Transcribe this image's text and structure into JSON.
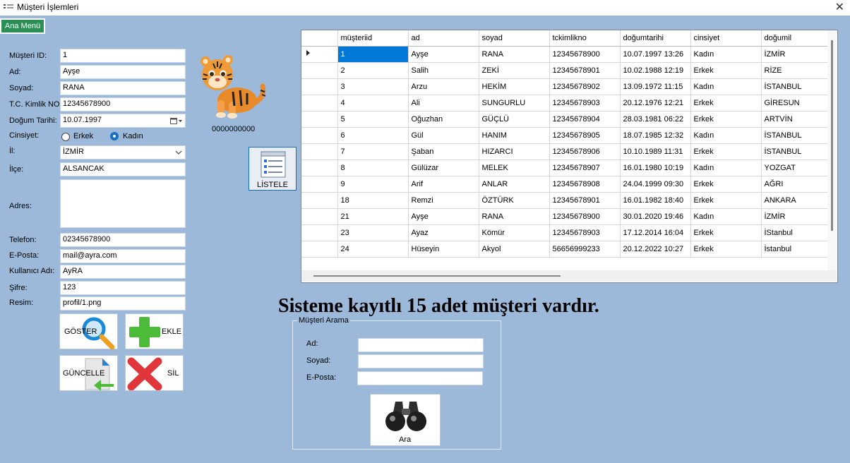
{
  "window": {
    "title": "Müşteri İşlemleri",
    "close_glyph": "✕"
  },
  "main_menu_button": "Ana Menü",
  "form": {
    "labels": {
      "id": "Müşteri ID:",
      "ad": "Ad:",
      "soyad": "Soyad:",
      "tc": "T.C. Kimlik NO:",
      "dogum": "Doğum Tarihi:",
      "cinsiyet": "Cinsiyet:",
      "il": "İl:",
      "ilce": "İlçe:",
      "adres": "Adres:",
      "telefon": "Telefon:",
      "eposta": "E-Posta:",
      "kullanici": "Kullanıcı Adı:",
      "sifre": "Şifre:",
      "resim": "Resim:"
    },
    "values": {
      "id": "1",
      "ad": "Ayşe",
      "soyad": "RANA",
      "tc": "12345678900",
      "dogum": "10.07.1997",
      "il": "İZMİR",
      "ilce": "ALSANCAK",
      "adres": "",
      "telefon": "02345678900",
      "eposta": "mail@ayra.com",
      "kullanici": "AyRA",
      "sifre": "123",
      "resim": "profil/1.png"
    },
    "gender_options": [
      "Erkek",
      "Kadın"
    ],
    "gender_selected": "Kadın"
  },
  "profile": {
    "phone_caption": "0000000000",
    "avatar_icon": "tiger-cub-icon"
  },
  "buttons": {
    "goster": "GÖSTER",
    "ekle": "EKLE",
    "guncelle": "GÜNCELLE",
    "sil": "SİL",
    "listele": "LİSTELE",
    "ara": "Ara"
  },
  "grid": {
    "columns": [
      "müşteriid",
      "ad",
      "soyad",
      "tckimlikno",
      "doğumtarihi",
      "cinsiyet",
      "doğumil"
    ],
    "rows": [
      [
        "1",
        "Ayşe",
        "RANA",
        "12345678900",
        "10.07.1997 13:26",
        "Kadın",
        "İZMİR"
      ],
      [
        "2",
        "Salih",
        "ZEKİ",
        "12345678901",
        "10.02.1988 12:19",
        "Erkek",
        "RİZE"
      ],
      [
        "3",
        "Arzu",
        "HEKİM",
        "12345678902",
        "13.09.1972 11:15",
        "Kadın",
        "İSTANBUL"
      ],
      [
        "4",
        "Ali",
        "SUNGURLU",
        "12345678903",
        "20.12.1976 12:21",
        "Erkek",
        "GİRESUN"
      ],
      [
        "5",
        "Oğuzhan",
        "GÜÇLÜ",
        "12345678904",
        "28.03.1981 06:22",
        "Erkek",
        "ARTVİN"
      ],
      [
        "6",
        "Gül",
        "HANIM",
        "12345678905",
        "18.07.1985 12:32",
        "Kadın",
        "İSTANBUL"
      ],
      [
        "7",
        "Şaban",
        "HIZARCI",
        "12345678906",
        "10.10.1989 11:31",
        "Erkek",
        "İSTANBUL"
      ],
      [
        "8",
        "Gülüzar",
        "MELEK",
        "12345678907",
        "16.01.1980 10:19",
        "Kadın",
        "YOZGAT"
      ],
      [
        "9",
        "Arif",
        "ANLAR",
        "12345678908",
        "24.04.1999 09:30",
        "Erkek",
        "AĞRI"
      ],
      [
        "18",
        "Remzi",
        "ÖZTÜRK",
        "12345678901",
        "16.01.1982 18:40",
        "Erkek",
        "ANKARA"
      ],
      [
        "21",
        "Ayşe",
        "RANA",
        "12345678900",
        "30.01.2020 19:46",
        "Kadın",
        "İZMİR"
      ],
      [
        "23",
        "Ayaz",
        "Kömür",
        "12345678903",
        "17.12.2014 16:04",
        "Erkek",
        "İStanbul"
      ],
      [
        "24",
        "Hüseyin",
        "Akyol",
        "56656999233",
        "20.12.2022 10:27",
        "Erkek",
        "İstanbul"
      ]
    ],
    "selected_row": 0
  },
  "count_text": "Sisteme kayıtlı 15 adet müşteri vardır.",
  "search": {
    "title": "Müşteri Arama",
    "labels": {
      "ad": "Ad:",
      "soyad": "Soyad:",
      "eposta": "E-Posta:"
    },
    "values": {
      "ad": "",
      "soyad": "",
      "eposta": ""
    }
  }
}
